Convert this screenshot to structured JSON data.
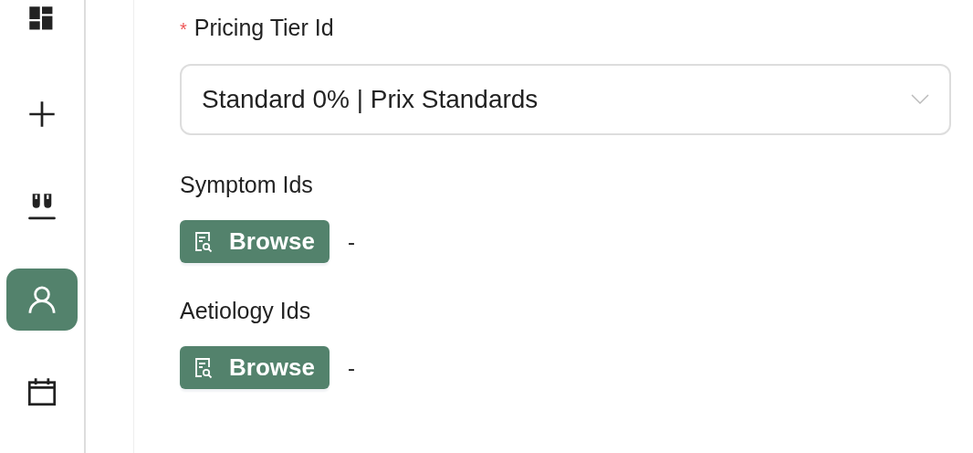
{
  "sidebar": {
    "items": [
      {
        "kind": "dashboard",
        "selected": false
      },
      {
        "kind": "plus",
        "selected": false
      },
      {
        "kind": "tubes",
        "selected": false
      },
      {
        "kind": "person",
        "selected": true
      },
      {
        "kind": "calendar",
        "selected": false
      }
    ]
  },
  "fields": [
    {
      "kind": "select",
      "required_mark": "*",
      "label": "Pricing Tier Id",
      "value": "Standard 0% | Prix Standards"
    },
    {
      "kind": "browse",
      "label": "Symptom Ids",
      "button": "Browse",
      "value": "-"
    },
    {
      "kind": "browse",
      "label": "Aetiology Ids",
      "button": "Browse",
      "value": "-"
    }
  ]
}
